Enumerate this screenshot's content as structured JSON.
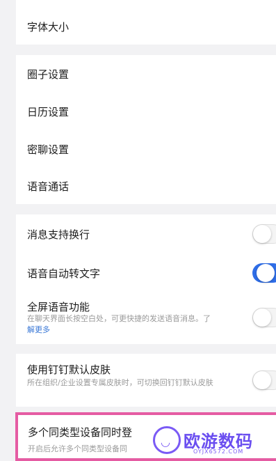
{
  "settings": {
    "font_size": "字体大小",
    "circle": "圈子设置",
    "calendar": "日历设置",
    "secret_chat": "密聊设置",
    "voice_call": "语音通话",
    "msg_wrap": {
      "label": "消息支持换行",
      "enabled": false
    },
    "voice_to_text": {
      "label": "语音自动转文字",
      "enabled": true
    },
    "fullscreen_voice": {
      "label": "全屏语音功能",
      "desc": "在聊天界面长按空白处，可更快捷的发送语音消息。了",
      "link": "解更多",
      "enabled": false
    },
    "default_skin": {
      "label": "使用钉钉默认皮肤",
      "desc": "所在组织/企业设置专属皮肤时，可切换回钉钉默认皮肤",
      "enabled": false
    },
    "multi_device": {
      "label": "多个同类型设备同时登",
      "desc": "开启后允许多个同类型设备同"
    }
  },
  "watermark": {
    "text": "欧游数码",
    "url": "OYJX6572.COM"
  }
}
